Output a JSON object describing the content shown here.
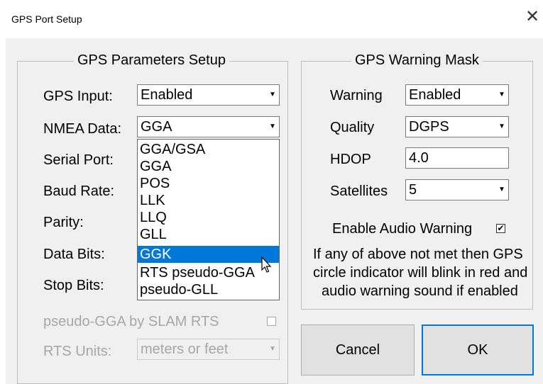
{
  "window": {
    "title": "GPS Port Setup",
    "close": "✕"
  },
  "params": {
    "group_title": "GPS Parameters Setup",
    "gps_input": {
      "label": "GPS Input:",
      "value": "Enabled"
    },
    "nmea_data": {
      "label": "NMEA Data:",
      "value": "GGA",
      "options": [
        "GGA/GSA",
        "GGA",
        "POS",
        "LLK",
        "LLQ",
        "GLL",
        "GGK",
        "RTS pseudo-GGA",
        "pseudo-GLL"
      ],
      "highlighted": "GGK"
    },
    "serial_port": {
      "label": "Serial Port:"
    },
    "baud_rate": {
      "label": "Baud Rate:"
    },
    "parity": {
      "label": "Parity:"
    },
    "data_bits": {
      "label": "Data Bits:"
    },
    "stop_bits": {
      "label": "Stop Bits:"
    },
    "pseudo_gga": {
      "label": "pseudo-GGA by SLAM RTS",
      "checked": false
    },
    "rts_units": {
      "label": "RTS Units:",
      "value": "meters or feet"
    }
  },
  "warning": {
    "group_title": "GPS Warning Mask",
    "warning": {
      "label": "Warning",
      "value": "Enabled"
    },
    "quality": {
      "label": "Quality",
      "value": "DGPS"
    },
    "hdop": {
      "label": "HDOP",
      "value": "4.0"
    },
    "satellites": {
      "label": "Satellites",
      "value": "5"
    },
    "audio": {
      "label": "Enable Audio Warning",
      "checked": true,
      "mark": "✔"
    },
    "note_line1": "If any of above not met then GPS",
    "note_line2": "circle indicator will blink in red and",
    "note_line3": "audio warning sound if enabled"
  },
  "buttons": {
    "cancel": "Cancel",
    "ok": "OK"
  },
  "icons": {
    "dropdown_arrow": "▼",
    "close": "close-icon",
    "cursor": "mouse-pointer-icon"
  },
  "colors": {
    "selection": "#0078d7",
    "disabled_text": "#a7a7a7"
  }
}
